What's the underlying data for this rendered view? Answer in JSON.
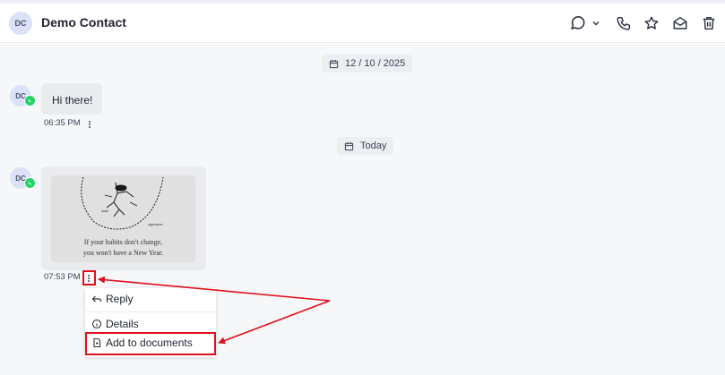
{
  "header": {
    "avatar_initials": "DC",
    "contact_name": "Demo Contact",
    "icons": [
      "chat-bubble-icon",
      "chevron-down-icon",
      "phone-icon",
      "star-icon",
      "mail-open-icon",
      "trash-icon"
    ]
  },
  "chat": {
    "date_separators": [
      "12 / 10 / 2025",
      "Today"
    ],
    "messages": [
      {
        "avatar_initials": "DC",
        "text": "Hi there!",
        "time": "06:35 PM",
        "channel_icon": "whatsapp-icon"
      },
      {
        "avatar_initials": "DC",
        "image_caption_line1": "If your habits don't change,",
        "image_caption_line2": "you won't have a New Year.",
        "time": "07:53 PM",
        "channel_icon": "whatsapp-icon"
      }
    ]
  },
  "context_menu": {
    "items": [
      {
        "label": "Reply",
        "icon": "reply-icon"
      },
      {
        "label": "Details",
        "icon": "info-icon"
      },
      {
        "label": "Add to documents",
        "icon": "document-icon"
      }
    ]
  },
  "colors": {
    "annotation_red": "#e0101a",
    "whatsapp_green": "#25d366",
    "avatar_bg": "#dbe1f6"
  }
}
